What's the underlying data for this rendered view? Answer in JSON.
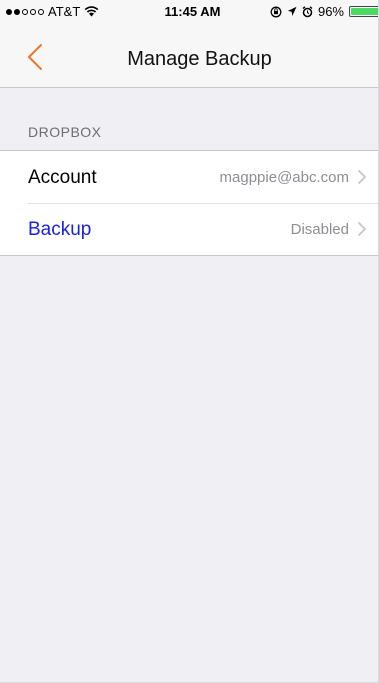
{
  "status_bar": {
    "carrier": "AT&T",
    "time": "11:45 AM",
    "battery": "96%",
    "battery_level": 0.96,
    "signal_strength": 2,
    "icons": [
      "wifi-icon",
      "screen-rotation-lock-icon",
      "location-arrow-icon",
      "alarm-icon",
      "battery-icon",
      "charging-icon"
    ]
  },
  "nav": {
    "title": "Manage Backup",
    "back_icon": "chevron-left-icon",
    "accent_color": "#e8772e"
  },
  "section": {
    "header": "DROPBOX"
  },
  "rows": [
    {
      "label": "Account",
      "value": "magppie@abc.com",
      "label_color": "#000000"
    },
    {
      "label": "Backup",
      "value": "Disabled",
      "label_color": "#1a23d8"
    }
  ]
}
